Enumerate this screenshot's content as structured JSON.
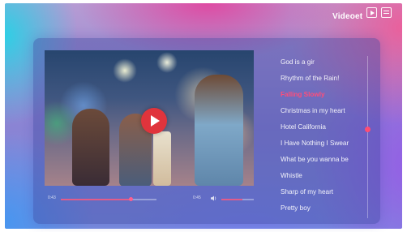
{
  "header": {
    "title": "Videoet"
  },
  "player": {
    "current_time": "0:43",
    "duration": "0:45",
    "progress": 0.73,
    "volume": 0.65
  },
  "playlist": {
    "songs": [
      "God is a gir",
      "Rhythm of the Rain!",
      "Falling Slowly",
      "Christmas in my heart",
      "Hotel California",
      "I Have Nothing I Swear",
      "What be you wanna be",
      "Whistle",
      "Sharp of my heart",
      "Pretty boy"
    ],
    "active_index": 2,
    "scroll_position": 0.45
  },
  "colors": {
    "accent": "#ff4d7a",
    "play_button": "#e0343c"
  },
  "icons": {
    "header_play": "play-icon",
    "header_list": "playlist-icon",
    "video_play": "play-icon",
    "volume": "volume-icon"
  }
}
